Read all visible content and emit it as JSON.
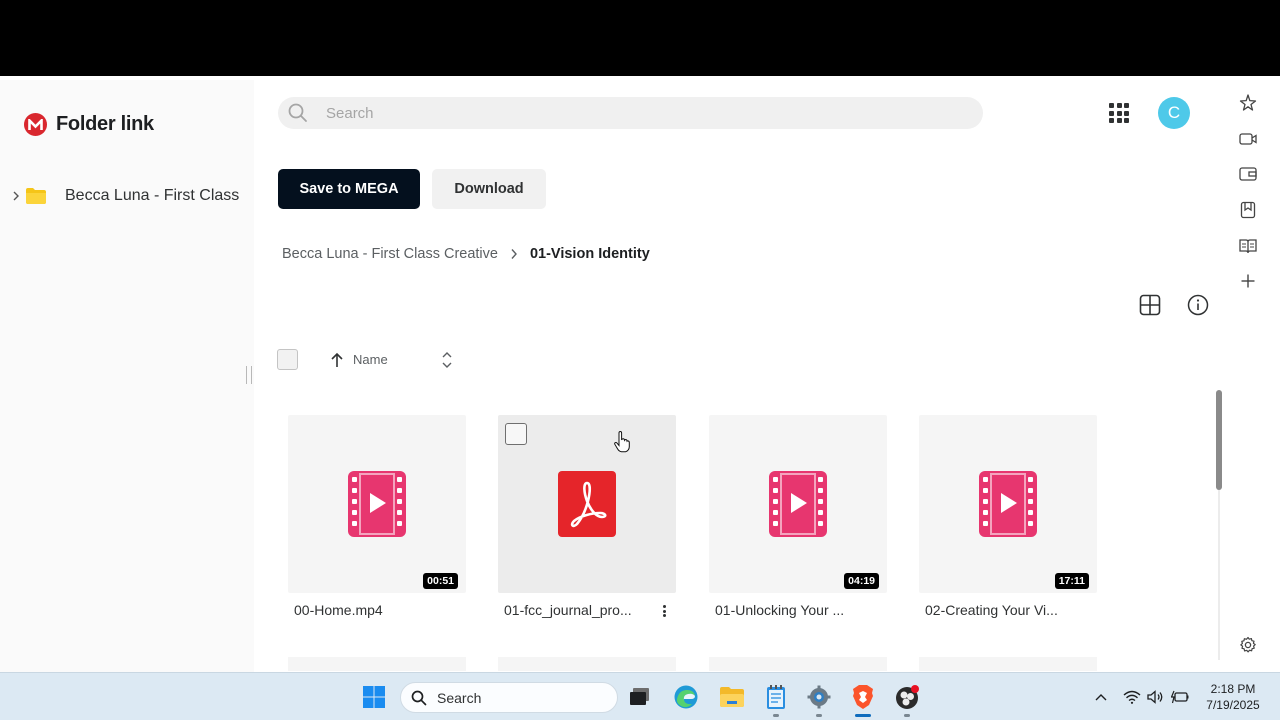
{
  "app": {
    "title": "Folder link"
  },
  "search": {
    "placeholder": "Search"
  },
  "user": {
    "avatar_initial": "C",
    "avatar_color": "#4ec9e9"
  },
  "sidebar": {
    "tree": [
      {
        "label": "Becca Luna - First Class Creative",
        "icon": "folder-icon",
        "expanded": false
      }
    ]
  },
  "toolbar": {
    "save_label": "Save to MEGA",
    "download_label": "Download"
  },
  "breadcrumb": {
    "parent": "Becca Luna - First Class Creative",
    "current": "01-Vision Identity"
  },
  "list_header": {
    "sort_label": "Name",
    "sort_direction": "ascending"
  },
  "files": [
    {
      "name": "00-Home.mp4",
      "type": "video",
      "duration": "00:51"
    },
    {
      "name": "01-fcc_journal_pro...",
      "type": "pdf",
      "duration": ""
    },
    {
      "name": "01-Unlocking Your ...",
      "type": "video",
      "duration": "04:19"
    },
    {
      "name": "02-Creating Your Vi...",
      "type": "video",
      "duration": "17:11"
    }
  ],
  "colors": {
    "brand_red": "#d9272e",
    "video_icon": "#e7366f",
    "pdf_icon": "#e5252a",
    "primary_button": "#04101e",
    "folder": "#f5c518"
  },
  "taskbar": {
    "search_label": "Search",
    "time": "2:18 PM",
    "date": "7/19/2025",
    "apps": [
      "windows-start-icon",
      "task-view-icon",
      "edge-icon",
      "file-explorer-icon",
      "notepad-icon",
      "settings-icon",
      "brave-icon",
      "obs-icon"
    ]
  }
}
